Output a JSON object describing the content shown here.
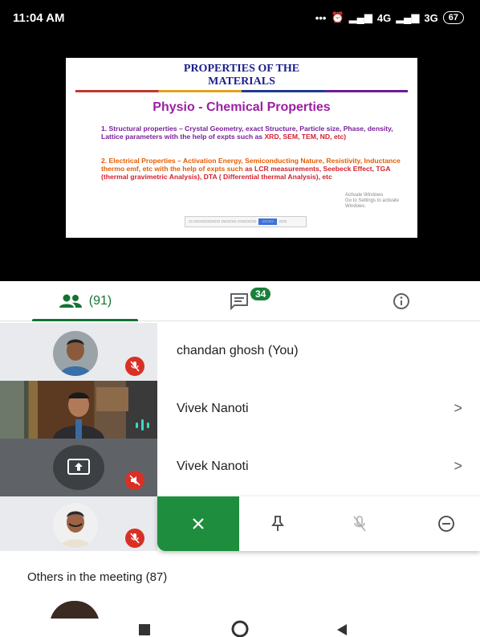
{
  "status": {
    "time": "11:04 AM",
    "signal1": "4G",
    "signal2": "3G",
    "battery": "67"
  },
  "slide": {
    "title": "PROPERTIES OF THE MATERIALS",
    "subtitle": "Physio - Chemical Properties",
    "p1_start": "1. Structural properties",
    "p1_mid": " – Crystal Geometry, exact Structure, Particle size, Phase, density, Lattice parameters with the help of expts such as ",
    "p1_red": "XRD, SEM,  TEM, ND, etc)",
    "p2_start": "2. Electrical Properties",
    "p2_mid": " – Activation Energy, Semiconducting Nature, Resistivity, Inductance thermo emf, etc with the help of expts such ",
    "p2_red": "as LCR measurements, Seebeck Effect, TGA (thermal gravimetric Analysis), DTA ( Differential thermal Analysis), etc",
    "activate_title": "Activate Windows",
    "activate_sub": "Go to Settings to activate Windows."
  },
  "tabs": {
    "people_count": "(91)",
    "chat_badge": "34"
  },
  "participants": [
    {
      "name": "chandan ghosh (You)"
    },
    {
      "name": "Vivek Nanoti"
    },
    {
      "name": "Vivek Nanoti"
    }
  ],
  "others_label": "Others in the meeting (87)",
  "colors": {
    "accent": "#137333",
    "mute": "#d93025",
    "action_bg": "#1e8e3e"
  }
}
